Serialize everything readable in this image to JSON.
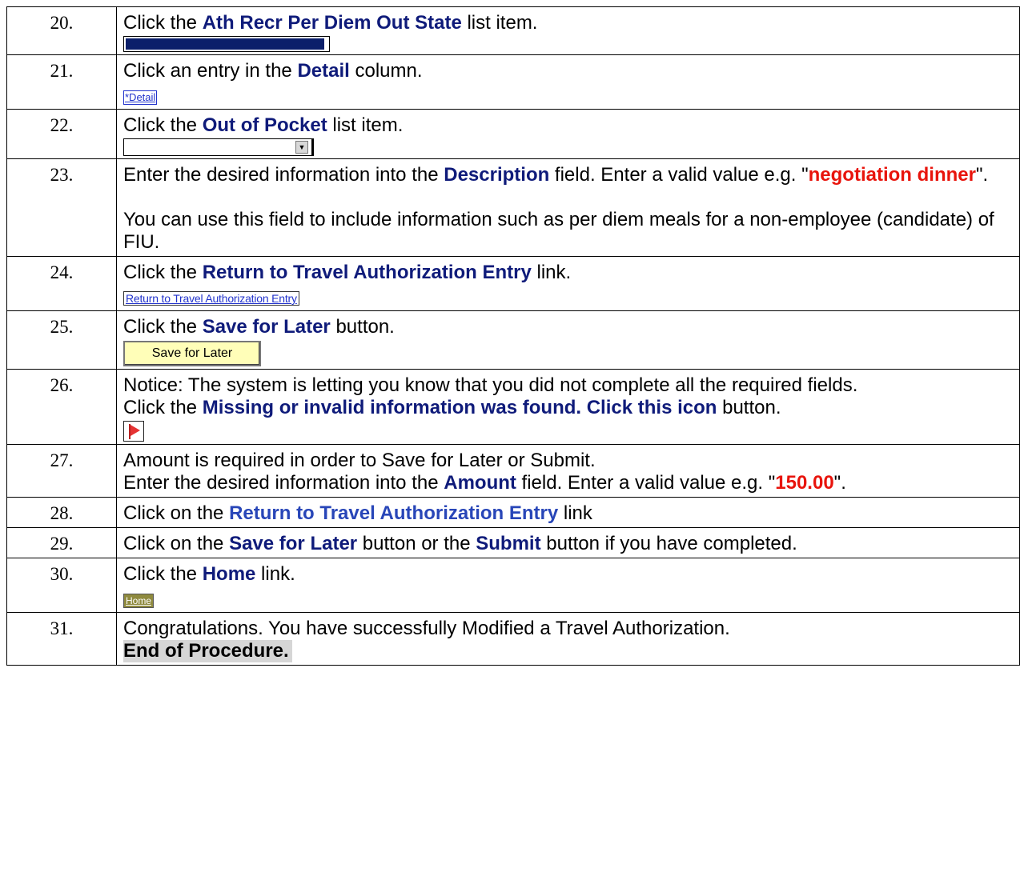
{
  "steps": [
    {
      "num": "20.",
      "lines": [
        [
          {
            "t": "Click the "
          },
          {
            "t": "Ath Recr Per Diem Out State",
            "s": "kw"
          },
          {
            "t": " list item."
          }
        ]
      ],
      "image": {
        "kind": "listitem"
      }
    },
    {
      "num": "21.",
      "lines": [
        [
          {
            "t": "Click an entry in the "
          },
          {
            "t": "Detail",
            "s": "kw"
          },
          {
            "t": " column."
          }
        ]
      ],
      "image": {
        "kind": "detail",
        "label": "*Detail"
      }
    },
    {
      "num": "22.",
      "lines": [
        [
          {
            "t": "Click the "
          },
          {
            "t": "Out of Pocket",
            "s": "kw"
          },
          {
            "t": " list item."
          }
        ]
      ],
      "image": {
        "kind": "dropdown",
        "arrow": "▼"
      }
    },
    {
      "num": "23.",
      "lines": [
        [
          {
            "t": "Enter the desired information into the "
          },
          {
            "t": "Description",
            "s": "kw"
          },
          {
            "t": " field. Enter a valid value e.g. \""
          },
          {
            "t": "negotiation dinner",
            "s": "val"
          },
          {
            "t": "\"."
          }
        ],
        [],
        [
          {
            "t": "You can use this field to include information such as per diem meals for a non-employee (candidate) of FIU."
          }
        ]
      ]
    },
    {
      "num": "24.",
      "lines": [
        [
          {
            "t": "Click the "
          },
          {
            "t": "Return to Travel Authorization Entry",
            "s": "kw"
          },
          {
            "t": " link."
          }
        ]
      ],
      "image": {
        "kind": "returnlink",
        "label": "Return to Travel Authorization Entry"
      }
    },
    {
      "num": "25.",
      "lines": [
        [
          {
            "t": "Click the "
          },
          {
            "t": "Save for Later",
            "s": "kw"
          },
          {
            "t": " button."
          }
        ]
      ],
      "image": {
        "kind": "savebutton",
        "label": "Save for Later"
      }
    },
    {
      "num": "26.",
      "lines": [
        [
          {
            "t": "Notice: The system is letting you know that you did not complete all the required fields."
          }
        ],
        [
          {
            "t": "Click the "
          },
          {
            "t": "Missing or invalid information was found. Click this icon",
            "s": "kw"
          },
          {
            "t": " button."
          }
        ]
      ],
      "image": {
        "kind": "flag"
      }
    },
    {
      "num": "27.",
      "lines": [
        [
          {
            "t": "Amount is required in order to Save for Later or Submit."
          }
        ],
        [
          {
            "t": "Enter the desired information into the "
          },
          {
            "t": "Amount",
            "s": "kw"
          },
          {
            "t": " field. Enter a valid value e.g. \""
          },
          {
            "t": "150.00",
            "s": "val"
          },
          {
            "t": "\"."
          }
        ]
      ]
    },
    {
      "num": "28.",
      "lines": [
        [
          {
            "t": "Click on the "
          },
          {
            "t": "Return to Travel Authorization Entry",
            "s": "lnk"
          },
          {
            "t": " link"
          }
        ]
      ]
    },
    {
      "num": "29.",
      "lines": [
        [
          {
            "t": "Click on the "
          },
          {
            "t": "Save for Later",
            "s": "kw"
          },
          {
            "t": " button or the "
          },
          {
            "t": "Submit",
            "s": "kw"
          },
          {
            "t": " button if you have completed."
          }
        ]
      ]
    },
    {
      "num": "30.",
      "lines": [
        [
          {
            "t": "Click the "
          },
          {
            "t": "Home",
            "s": "kw"
          },
          {
            "t": " link."
          }
        ]
      ],
      "image": {
        "kind": "home",
        "label": "Home"
      }
    },
    {
      "num": "31.",
      "lines": [
        [
          {
            "t": "Congratulations. You have successfully Modified a Travel Authorization."
          }
        ]
      ],
      "end": "End of Procedure."
    }
  ]
}
